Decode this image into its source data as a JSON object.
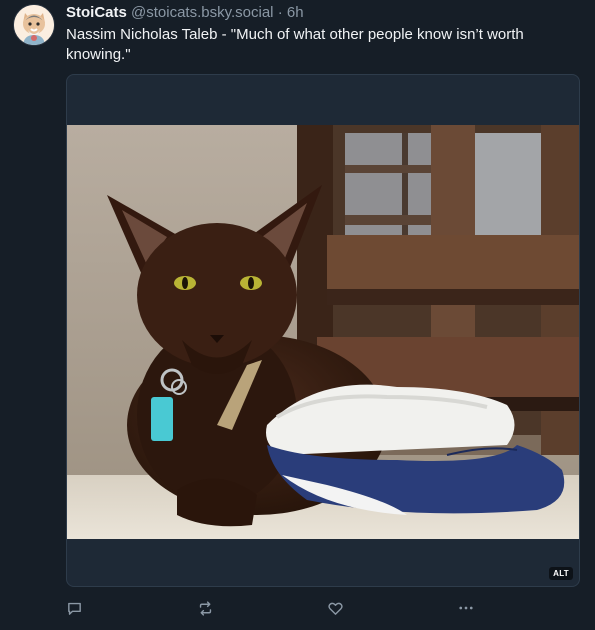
{
  "post": {
    "author_name": "StoiCats",
    "author_handle": "@stoicats.bsky.social",
    "separator": "·",
    "time": "6h",
    "text": "Nassim Nicholas Taleb - \"Much of what other people know isn’t worth knowing.\""
  },
  "media": {
    "alt_badge": "ALT"
  },
  "actions": {
    "icons": [
      "reply-icon",
      "repost-icon",
      "like-icon",
      "more-icon"
    ]
  },
  "colors": {
    "background": "#161e27",
    "card": "#1e2936",
    "muted_text": "#8b98a5"
  }
}
